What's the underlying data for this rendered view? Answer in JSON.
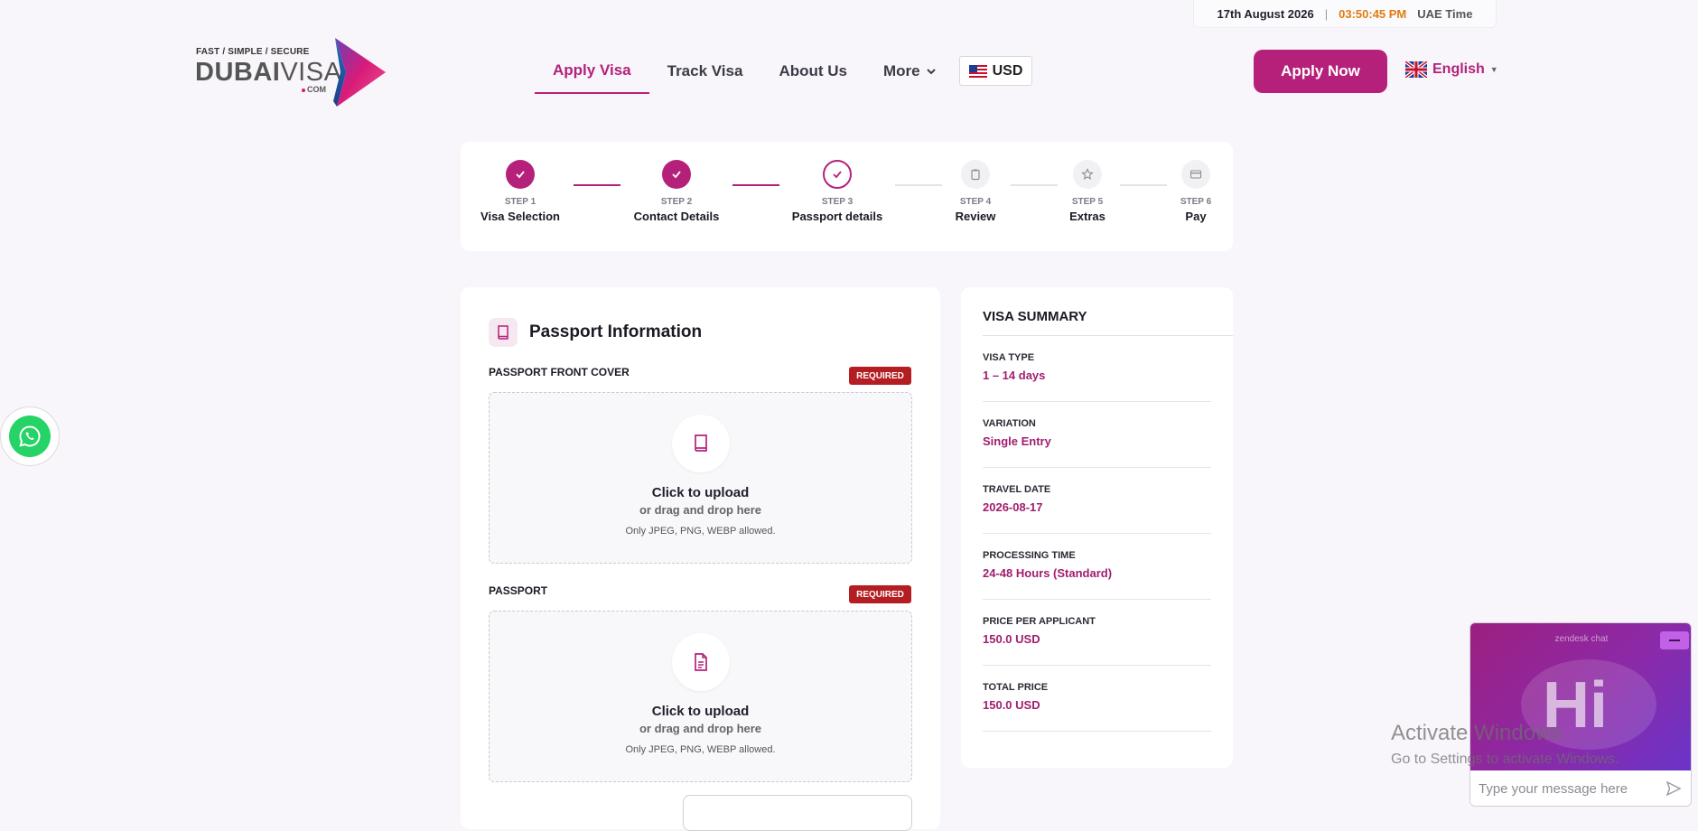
{
  "timebar": {
    "date": "17th August 2026",
    "separator": "|",
    "time": "03:50:45 PM",
    "zone": "UAE Time"
  },
  "logo": {
    "tagline": "FAST / SIMPLE / SECURE",
    "brand_bold": "DUBAI",
    "brand_light": "VISA",
    "suffix": "COM"
  },
  "nav": {
    "items": [
      {
        "label": "Apply Visa",
        "active": true
      },
      {
        "label": "Track Visa"
      },
      {
        "label": "About Us"
      },
      {
        "label": "More"
      }
    ],
    "currency": "USD",
    "apply_now": "Apply Now",
    "language": "English"
  },
  "steps": [
    {
      "num": "STEP 1",
      "name": "Visa Selection",
      "state": "done",
      "icon": "check-icon"
    },
    {
      "num": "STEP 2",
      "name": "Contact Details",
      "state": "done",
      "icon": "check-icon"
    },
    {
      "num": "STEP 3",
      "name": "Passport details",
      "state": "current",
      "icon": "check-icon"
    },
    {
      "num": "STEP 4",
      "name": "Review",
      "state": "todo",
      "icon": "clipboard-icon"
    },
    {
      "num": "STEP 5",
      "name": "Extras",
      "state": "todo",
      "icon": "star-icon"
    },
    {
      "num": "STEP 6",
      "name": "Pay",
      "state": "todo",
      "icon": "card-icon"
    }
  ],
  "passport": {
    "title": "Passport Information",
    "fields": [
      {
        "label": "PASSPORT FRONT COVER",
        "badge": "REQUIRED",
        "upload": "Click to upload",
        "drag": "or drag and drop here",
        "allowed": "Only JPEG, PNG, WEBP allowed.",
        "icon": "book-icon"
      },
      {
        "label": "PASSPORT",
        "badge": "REQUIRED",
        "upload": "Click to upload",
        "drag": "or drag and drop here",
        "allowed": "Only JPEG, PNG, WEBP allowed.",
        "icon": "document-icon"
      }
    ]
  },
  "summary": {
    "title": "VISA SUMMARY",
    "rows": [
      {
        "label": "VISA TYPE",
        "value": "1 – 14 days"
      },
      {
        "label": "VARIATION",
        "value": "Single Entry"
      },
      {
        "label": "TRAVEL DATE",
        "value": "2026-08-17"
      },
      {
        "label": "PROCESSING TIME",
        "value": "24-48 Hours (Standard)"
      },
      {
        "label": "PRICE PER APPLICANT",
        "value": "150.0 USD"
      },
      {
        "label": "TOTAL PRICE",
        "value": "150.0 USD"
      }
    ]
  },
  "chat": {
    "label": "zendesk chat",
    "greeting": "Hi",
    "placeholder": "Type your message here"
  },
  "watermark": {
    "line1": "Activate Windows",
    "line2": "Go to Settings to activate Windows."
  },
  "colors": {
    "brand": "#b5217a",
    "required": "#b41d22",
    "time": "#e07b12",
    "whatsapp": "#25d366"
  }
}
